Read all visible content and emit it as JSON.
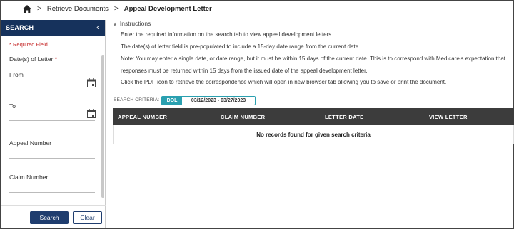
{
  "breadcrumb": {
    "items": [
      "Retrieve Documents"
    ],
    "current": "Appeal Development Letter",
    "separator": ">"
  },
  "sidebar": {
    "title": "SEARCH",
    "collapse_icon": "chevron-left-icon",
    "required_note": "* Required Field",
    "date_label": "Date(s) of Letter",
    "required_star": "*",
    "from_label": "From",
    "to_label": "To",
    "appeal_number_label": "Appeal Number",
    "claim_number_label": "Claim Number",
    "search_button": "Search",
    "clear_button": "Clear"
  },
  "instructions": {
    "toggle_label": "Instructions",
    "lines": [
      "Enter the required information on the search tab to view appeal development letters.",
      "The date(s) of letter field is pre-populated to include a 15-day date range from the current date.",
      "Note: You may enter a single date, or date range, but it must be within 15 days of the current date. This is to correspond with Medicare's expectation that",
      "responses must be returned within 15 days from the issued date of the appeal development letter.",
      "Click the PDF icon to retrieve the correspondence which will open in new browser tab allowing you to save or print the document."
    ]
  },
  "criteria": {
    "label": "SEARCH CRITERIA:",
    "tag": "DOL",
    "range": "03/12/2023 - 03/27/2023"
  },
  "table": {
    "columns": [
      "APPEAL NUMBER",
      "CLAIM NUMBER",
      "LETTER DATE",
      "VIEW LETTER"
    ],
    "empty_message": "No records found for given search criteria"
  },
  "colors": {
    "header_navy": "#16325c",
    "button_navy": "#1f3d6e",
    "required_red": "#c62828",
    "criteria_teal": "#2aa0b0",
    "table_head": "#3c3c3c"
  }
}
